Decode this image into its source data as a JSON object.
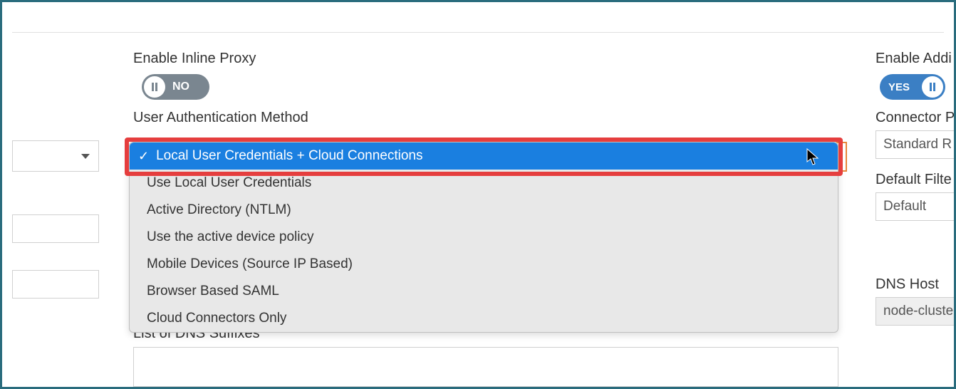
{
  "center": {
    "enable_inline_proxy_label": "Enable Inline Proxy",
    "enable_inline_proxy_value": "NO",
    "auth_method_label": "User Authentication Method",
    "auth_options": [
      "Local User Credentials + Cloud Connections",
      "Use Local User Credentials",
      "Active Directory (NTLM)",
      "Use the active device policy",
      "Mobile Devices (Source IP Based)",
      "Browser Based SAML",
      "Cloud Connectors Only"
    ],
    "dns_suffixes_label": "List of DNS Suffixes"
  },
  "right": {
    "enable_addi_label": "Enable Addi",
    "enable_addi_value": "YES",
    "connector_label": "Connector P",
    "connector_value": "Standard R",
    "default_filter_label": "Default Filte",
    "default_filter_value": "Default",
    "dns_host_label": "DNS Host",
    "dns_host_value": "node-cluste"
  }
}
